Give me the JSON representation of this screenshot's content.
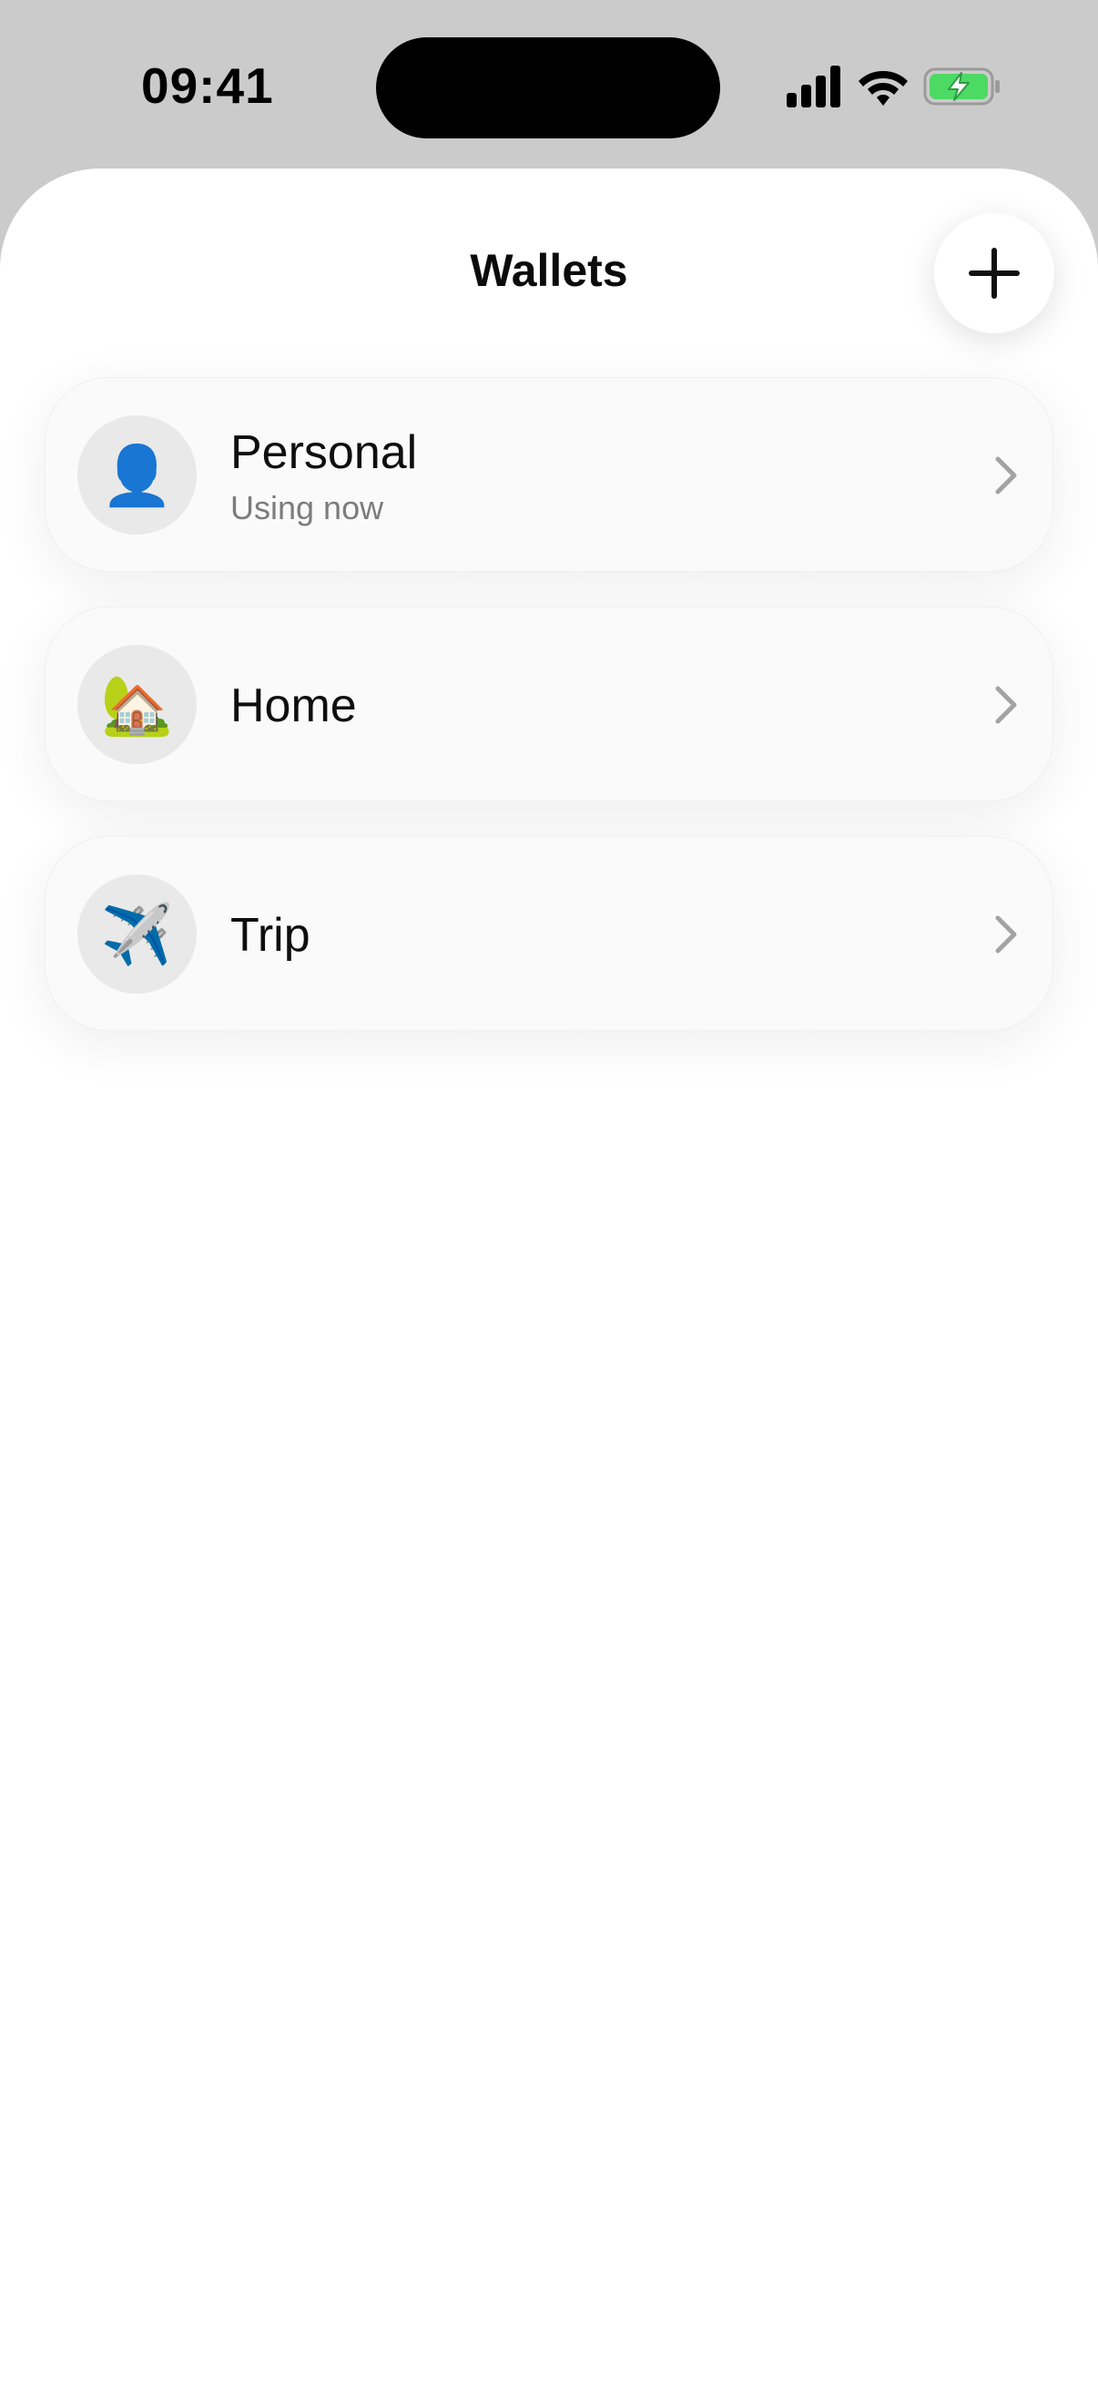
{
  "status_bar": {
    "time": "09:41",
    "icons": [
      "cellular-signal-icon",
      "wifi-icon",
      "battery-charging-icon"
    ],
    "battery_color": "#4cd964"
  },
  "header": {
    "title": "Wallets",
    "add_icon": "plus-icon"
  },
  "wallets": [
    {
      "name": "Personal",
      "subtitle": "Using now",
      "emoji": "👤",
      "icon": "person-silhouette-icon"
    },
    {
      "name": "Home",
      "subtitle": "",
      "emoji": "🏡",
      "icon": "house-icon"
    },
    {
      "name": "Trip",
      "subtitle": "",
      "emoji": "✈️",
      "icon": "airplane-icon"
    }
  ],
  "colors": {
    "background": "#cbcbcb",
    "sheet": "#ffffff",
    "card": "#fafafa",
    "avatar_bg": "#e9e9e9",
    "secondary_text": "#7c7c7c"
  }
}
